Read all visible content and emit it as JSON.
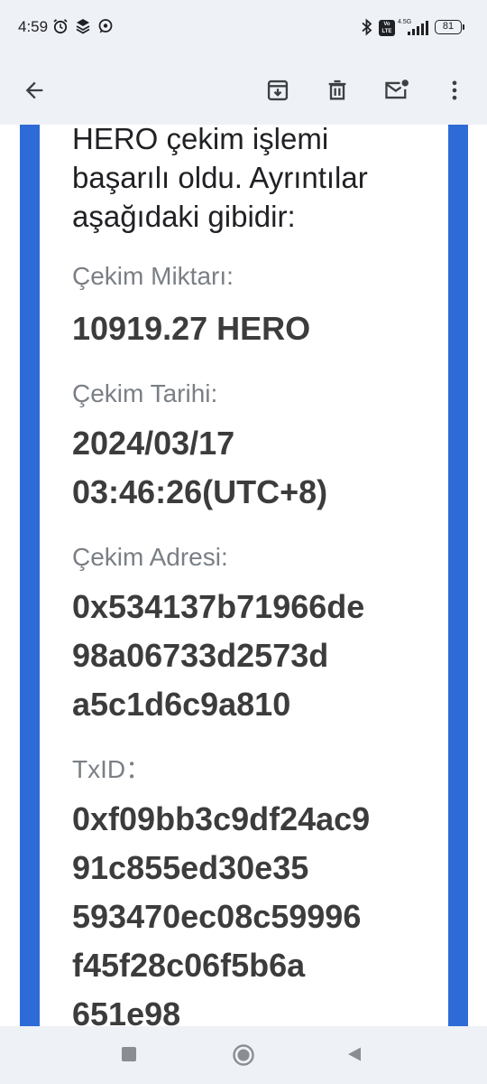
{
  "status_bar": {
    "time": "4:59",
    "battery": "81",
    "icons": [
      "alarm-icon",
      "stack-icon",
      "chat-bubble-icon",
      "bluetooth-icon",
      "volte-icon",
      "signal-icon"
    ],
    "network_label": "4.5G",
    "volte_label": "Vo LTE"
  },
  "toolbar": {
    "actions": [
      "back-arrow-icon",
      "archive-icon",
      "delete-icon",
      "mark-unread-icon",
      "more-vert-icon"
    ]
  },
  "email": {
    "intro_lines": [
      "HERO çekim işlemi",
      "başarılı oldu. Ayrıntılar",
      "aşağıdaki gibidir:"
    ],
    "amount_label": "Çekim Miktarı:",
    "amount_value": "10919.27 HERO",
    "date_label": "Çekim Tarihi:",
    "date_line1": "2024/03/17",
    "date_line2": "03:46:26(UTC+8)",
    "address_label": "Çekim Adresi:",
    "address_lines": [
      "0x534137b71966de",
      "98a06733d2573d",
      "a5c1d6c9a810"
    ],
    "txid_label": "TxID：",
    "txid_lines": [
      "0xf09bb3c9df24ac9",
      "91c855ed30e35",
      "593470ec08c59996",
      "f45f28c06f5b6a",
      "651e98"
    ]
  },
  "colors": {
    "accent_bar": "#2f6bd6",
    "chrome_bg": "#eef1f5"
  }
}
